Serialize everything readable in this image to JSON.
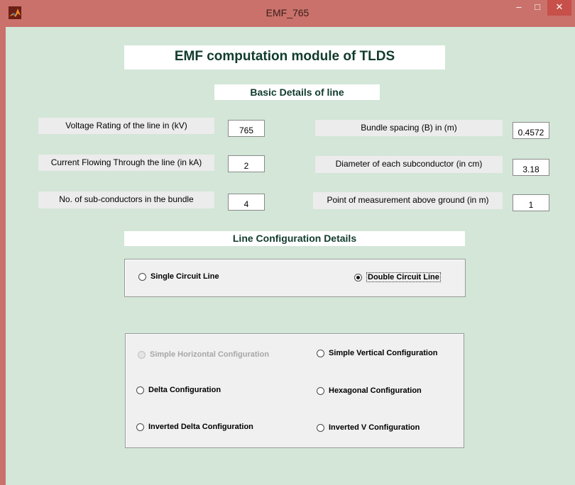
{
  "window": {
    "title": "EMF_765",
    "min_glyph": "–",
    "max_glyph": "□",
    "close_glyph": "✕"
  },
  "header": {
    "title": "EMF computation module of TLDS"
  },
  "basic": {
    "section_title": "Basic Details of line",
    "fields": [
      {
        "label": "Voltage Rating of the line in (kV)",
        "value": "765"
      },
      {
        "label": "Current Flowing Through the line (in kA)",
        "value": "2"
      },
      {
        "label": "No. of sub-conductors in the bundle",
        "value": "4"
      },
      {
        "label": "Bundle spacing (B) in (m)",
        "value": "0.4572"
      },
      {
        "label": "Diameter of each subconductor (in cm)",
        "value": "3.18"
      },
      {
        "label": "Point of measurement above ground (in m)",
        "value": "1"
      }
    ]
  },
  "line_config": {
    "section_title": "Line Configuration Details",
    "circuit_options": [
      {
        "label": "Single Circuit Line",
        "selected": false
      },
      {
        "label": "Double Circuit Line",
        "selected": true
      }
    ],
    "config_options": [
      {
        "label": "Simple Horizontal Configuration",
        "enabled": false,
        "selected": false
      },
      {
        "label": "Simple Vertical Configuration",
        "enabled": true,
        "selected": false
      },
      {
        "label": "Delta Configuration",
        "enabled": true,
        "selected": false
      },
      {
        "label": "Hexagonal Configuration",
        "enabled": true,
        "selected": false
      },
      {
        "label": "Inverted Delta Configuration",
        "enabled": true,
        "selected": false
      },
      {
        "label": "Inverted V Configuration",
        "enabled": true,
        "selected": false
      }
    ]
  },
  "colors": {
    "titlebar": "#c9716a",
    "client_bg": "#d3e6d8",
    "heading_text": "#113b2e",
    "close_button": "#c7504a"
  }
}
